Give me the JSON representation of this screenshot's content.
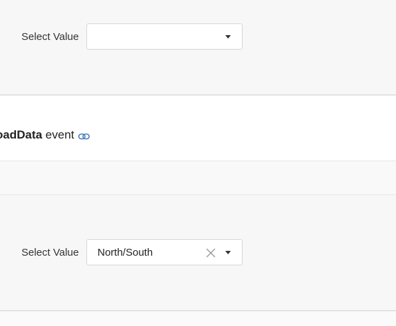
{
  "top_demo": {
    "select_label": "Select Value",
    "select_value": ""
  },
  "section": {
    "title_bold": "oadData",
    "title_rest": " event",
    "anchor_icon": "link-icon"
  },
  "bottom_demo": {
    "select_label": "Select Value",
    "select_value": "North/South",
    "clear_icon": "close-icon",
    "dropdown_icon": "caret-down-icon"
  }
}
